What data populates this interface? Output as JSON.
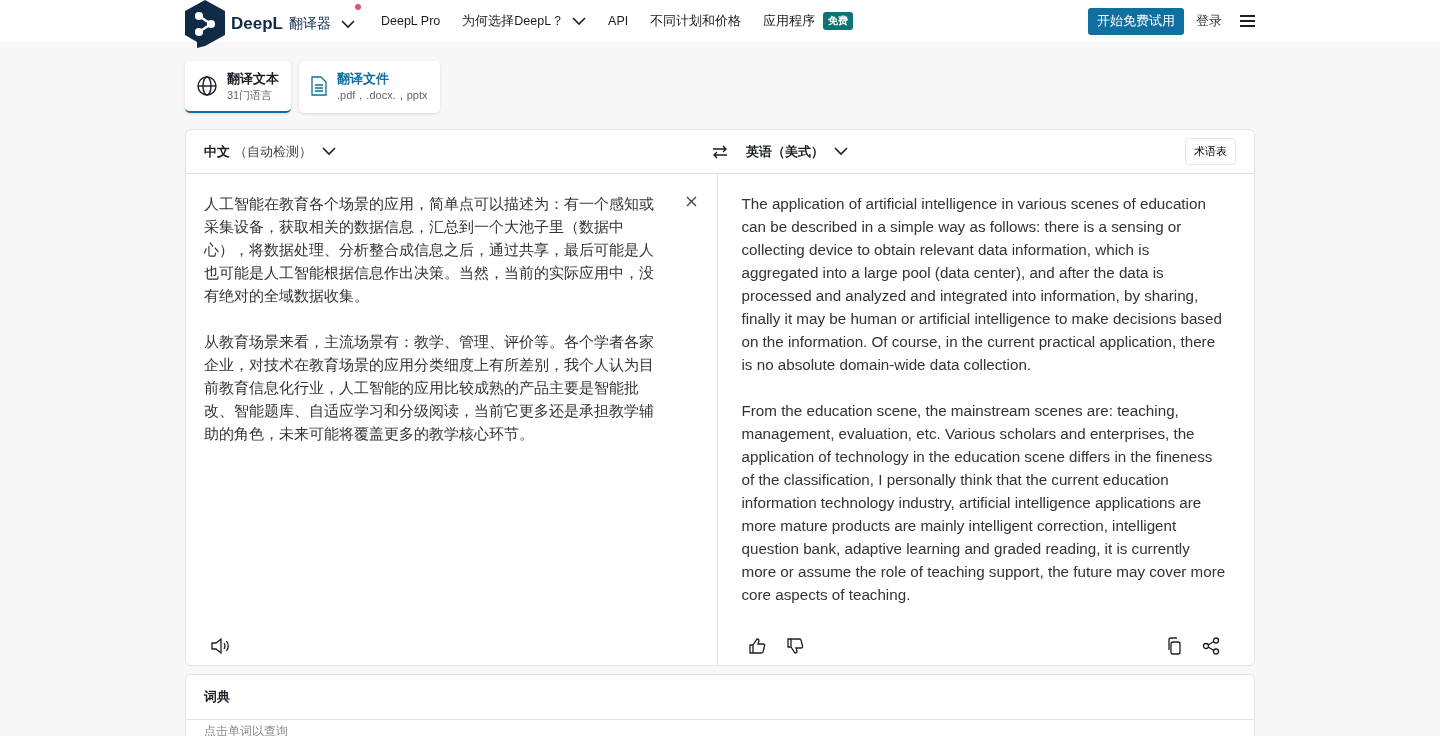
{
  "header": {
    "brand": "DeepL",
    "product": "翻译器",
    "nav": [
      {
        "label": "DeepL Pro",
        "dropdown": false
      },
      {
        "label": "为何选择DeepL？",
        "dropdown": true
      },
      {
        "label": "API",
        "dropdown": false
      },
      {
        "label": "不同计划和价格",
        "dropdown": false
      },
      {
        "label": "应用程序",
        "dropdown": false,
        "badge": "免费"
      }
    ],
    "cta": "开始免费试用",
    "login": "登录"
  },
  "tabs": [
    {
      "kind": "text",
      "title": "翻译文本",
      "subtitle": "31门语言",
      "selected": true
    },
    {
      "kind": "file",
      "title": "翻译文件",
      "subtitle": ".pdf，.docx.，pptx",
      "selected": false
    }
  ],
  "translator": {
    "source_language": "中文",
    "source_hint": "（自动检测）",
    "target_language": "英语（美式）",
    "glossary": "术语表",
    "source_text": [
      "人工智能在教育各个场景的应用，简单点可以描述为：有一个感知或采集设备，获取相关的数据信息，汇总到一个大池子里（数据中心），将数据处理、分析整合成信息之后，通过共享，最后可能是人也可能是人工智能根据信息作出决策。当然，当前的实际应用中，没有绝对的全域数据收集。",
      "从教育场景来看，主流场景有：教学、管理、评价等。各个学者各家企业，对技术在教育场景的应用分类细度上有所差别，我个人认为目前教育信息化行业，人工智能的应用比较成熟的产品主要是智能批改、智能题库、自适应学习和分级阅读，当前它更多还是承担教学辅助的角色，未来可能将覆盖更多的教学核心环节。"
    ],
    "target_text": [
      "The application of artificial intelligence in various scenes of education can be described in a simple way as follows: there is a sensing or collecting device to obtain relevant data information, which is aggregated into a large pool (data center), and after the data is processed and analyzed and integrated into information, by sharing, finally it may be human or artificial intelligence to make decisions based on the information. Of course, in the current practical application, there is no absolute domain-wide data collection.",
      "From the education scene, the mainstream scenes are: teaching, management, evaluation, etc. Various scholars and enterprises, the application of technology in the education scene differs in the fineness of the classification, I personally think that the current education information technology industry, artificial intelligence applications are more mature products are mainly intelligent correction, intelligent question bank, adaptive learning and graded reading, it is currently more or assume the role of teaching support, the future may cover more core aspects of teaching."
    ]
  },
  "dictionary": {
    "title": "词典",
    "hint": "点击单词以查询"
  }
}
